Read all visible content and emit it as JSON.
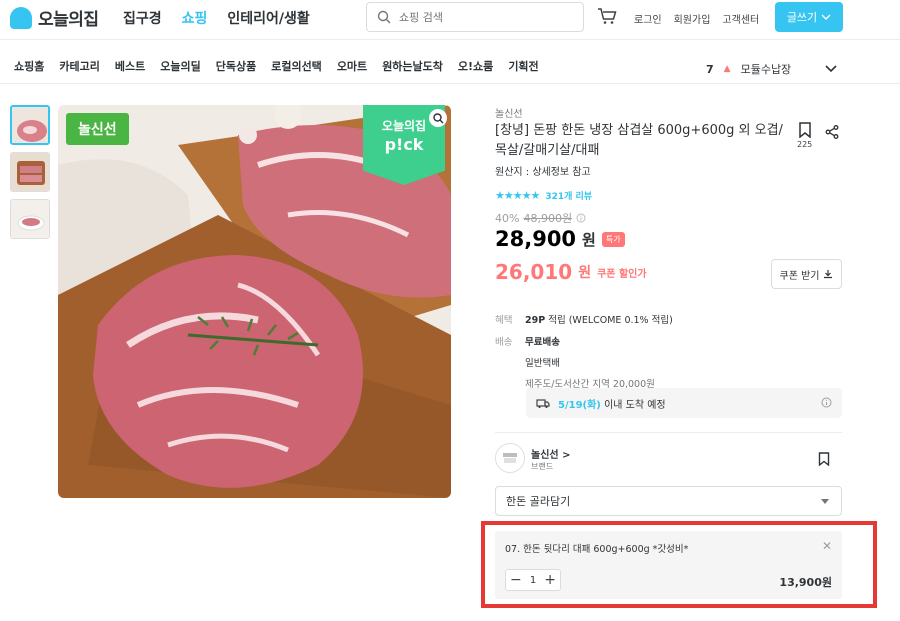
{
  "header": {
    "logo_text": "오늘의집",
    "nav": [
      {
        "label": "집구경",
        "active": false
      },
      {
        "label": "쇼핑",
        "active": true
      },
      {
        "label": "인테리어/생활",
        "active": false
      }
    ],
    "search_placeholder": "쇼핑 검색",
    "util": [
      "로그인",
      "회원가입",
      "고객센터"
    ],
    "write_label": "글쓰기"
  },
  "subnav": {
    "items": [
      "쇼핑홈",
      "카테고리",
      "베스트",
      "오늘의딜",
      "단독상품",
      "로컬의선택",
      "오마트",
      "원하는날도착",
      "오!쇼룸",
      "기획전"
    ],
    "ranking_num": "7",
    "ranking_term": "모듈수납장"
  },
  "gallery": {
    "badge_left": "놀신선",
    "pick_top": "오늘의집",
    "pick_bottom": "p!ck"
  },
  "product": {
    "brand": "놀신선",
    "title": "[창녕] 돈팡 한돈 냉장 삼겹살 600g+600g 외 오겹/목살/갈매기살/대패",
    "origin": "원산지 : 상세정보 참고",
    "bookmark_count": "225",
    "stars": "★★★★★",
    "review_count": "321개 리뷰",
    "discount_rate": "40%",
    "original_price": "48,900원",
    "price": "28,900",
    "price_unit": "원",
    "special_badge": "특가",
    "coupon_price": "26,010",
    "coupon_unit": "원",
    "coupon_label": "쿠폰 할인가",
    "coupon_button": "쿠폰 받기"
  },
  "benefit": {
    "label": "혜택",
    "points": "29P",
    "desc": "적립 (WELCOME 0.1% 적립)"
  },
  "shipping": {
    "label": "배송",
    "fee": "무료배송",
    "method": "일반택배",
    "extra": "제주도/도서산간 지역 20,000원",
    "arrival_date": "5/19(화)",
    "arrival_text": "이내 도착 예정"
  },
  "seller": {
    "name": "놀신선 >",
    "type": "브랜드"
  },
  "option_select": {
    "value": "한돈 골라담기"
  },
  "selected_option": {
    "name": "07. 한돈 뒷다리 대패 600g+600g *갓성비*",
    "quantity": "1",
    "price": "13,900원"
  }
}
